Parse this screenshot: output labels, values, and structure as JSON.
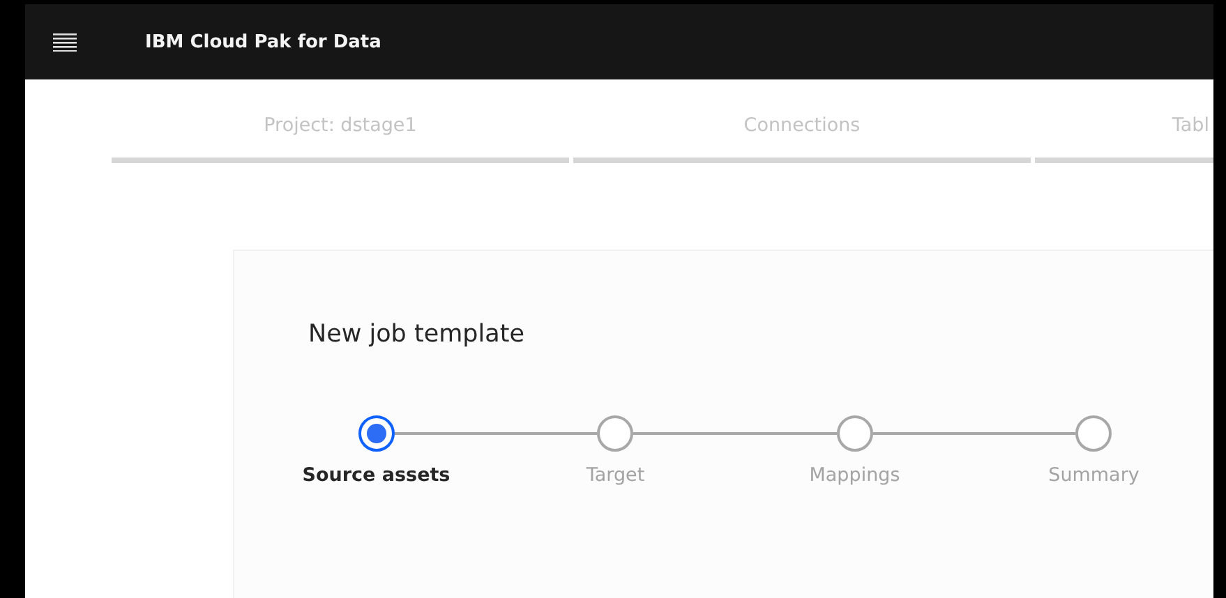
{
  "header": {
    "title": "IBM Cloud Pak for Data"
  },
  "breadcrumb_tabs": [
    {
      "label": "Project: dstage1",
      "clipped": false
    },
    {
      "label": "Connections",
      "clipped": false
    },
    {
      "label": "Tabl",
      "clipped": true
    }
  ],
  "card": {
    "title": "New job template"
  },
  "steps": [
    {
      "label": "Source assets",
      "selected": true
    },
    {
      "label": "Target",
      "selected": false
    },
    {
      "label": "Mappings",
      "selected": false
    },
    {
      "label": "Summary",
      "selected": false
    }
  ]
}
